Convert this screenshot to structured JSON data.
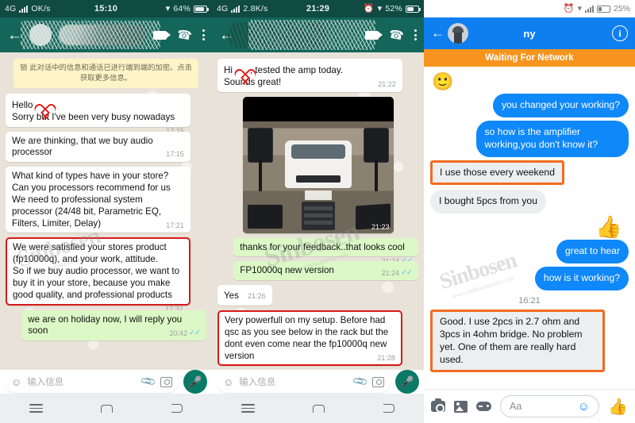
{
  "brand": {
    "watermark": "Sinbosen",
    "watermark_sub": "www.sinbosenaudio.com"
  },
  "colors": {
    "whatsapp_header": "#14655a",
    "whatsapp_statusbar": "#0f4a43",
    "whatsapp_outgoing_bubble": "#dcf8c6",
    "messenger_blue": "#0f88fa",
    "messenger_banner_orange": "#f7941e",
    "highlight_red": "#d81a1a",
    "highlight_orange": "#f26b21"
  },
  "panel1": {
    "app": "whatsapp",
    "status_bar": {
      "network": "4G",
      "speed": "OK/s",
      "time": "15:10",
      "battery": "64%",
      "wifi_icon": "wifi-icon",
      "signal_icon": "signal-bars-icon",
      "battery_icon": "battery-icon"
    },
    "header": {
      "back_icon": "back-arrow-icon",
      "contact_name": "",
      "video_icon": "video-call-icon",
      "call_icon": "voice-call-icon",
      "menu_icon": "overflow-menu-icon",
      "avatar": "contact-avatar"
    },
    "encryption_notice": "锁 此对话中的信息和通话已进行端到端的加密。点击获取更多信息。",
    "messages": [
      {
        "side": "in",
        "text": "Hello ♥\nSorry but I've been very busy nowadays",
        "time": "17:15",
        "highlight": false,
        "has_heart": true
      },
      {
        "side": "in",
        "text": "We are thinking, that we buy audio processor",
        "time": "17:15",
        "highlight": false
      },
      {
        "side": "in",
        "text": "What kind of types have in your store?\nCan you processors recommend for us\nWe need to professional system processor (24/48 bit, Parametric EQ, Filters, Limiter, Delay)",
        "time": "17:21",
        "highlight": false
      },
      {
        "side": "in",
        "text": "We were satisfied your stores product (fp10000q), and your work, attitude.\nSo if we buy audio processor, we want to buy it in your store, because you make good quality, and professional products",
        "time": "17:32",
        "highlight": true
      },
      {
        "side": "out",
        "text": "we are on holiday now, I will reply you soon",
        "time": "20:42",
        "highlight": false,
        "ticks": "✓✓"
      }
    ],
    "input": {
      "placeholder": "输入信息",
      "emoji_icon": "emoji-icon",
      "attach_icon": "attachment-clip-icon",
      "camera_icon": "camera-icon",
      "mic_icon": "microphone-icon"
    },
    "navbar": {
      "menu_icon": "android-recents-icon",
      "home_icon": "android-home-icon",
      "back_icon": "android-back-icon"
    }
  },
  "panel2": {
    "app": "whatsapp",
    "status_bar": {
      "network": "4G",
      "speed": "2.8K/s",
      "time": "21:29",
      "battery": "52%",
      "alarm_icon": "alarm-clock-icon",
      "wifi_icon": "wifi-icon",
      "signal_icon": "signal-bars-icon",
      "battery_icon": "battery-icon"
    },
    "header": {
      "back_icon": "back-arrow-icon",
      "contact_name": "",
      "video_icon": "video-call-icon",
      "call_icon": "voice-call-icon",
      "menu_icon": "overflow-menu-icon"
    },
    "messages": [
      {
        "side": "in",
        "text": "Hi ♥, tested the amp today.\nSounds great!",
        "time": "21:22",
        "highlight": false,
        "has_heart": true
      },
      {
        "side": "in",
        "type": "photo",
        "caption": "Photo of a white van in a garage with two PA speakers on stands, subwoofer cabinets and an amplifier rack",
        "time": "21:23",
        "forward_icon": "forward-arrow-icon"
      },
      {
        "side": "out",
        "text": "thanks for your feedback..that looks cool",
        "time": "21:24",
        "highlight": false,
        "ticks": "✓✓"
      },
      {
        "side": "out",
        "text": "FP10000q new version",
        "time": "21:24",
        "highlight": false,
        "ticks": "✓✓"
      },
      {
        "side": "in",
        "text": "Yes",
        "time": "21:26",
        "highlight": false,
        "inline_time": true
      },
      {
        "side": "in",
        "text": "Very powerfull on my setup. Before had qsc as you see below in the rack but the dont even come near the fp10000q new version",
        "time": "21:28",
        "highlight": true
      }
    ],
    "input": {
      "placeholder": "输入信息",
      "emoji_icon": "emoji-icon",
      "attach_icon": "attachment-clip-icon",
      "camera_icon": "camera-icon",
      "mic_icon": "microphone-icon"
    },
    "navbar": {
      "menu_icon": "android-recents-icon",
      "home_icon": "android-home-icon",
      "back_icon": "android-back-icon"
    }
  },
  "panel3": {
    "app": "messenger",
    "status_bar": {
      "battery": "25%",
      "alarm_icon": "alarm-clock-icon",
      "wifi_icon": "wifi-icon",
      "signal_icon": "signal-bars-icon",
      "battery_icon": "battery-icon"
    },
    "header": {
      "back_icon": "back-arrow-icon",
      "contact_name": "ny",
      "info_icon": "info-circle-icon",
      "avatar": "contact-avatar"
    },
    "banner": "Waiting For Network",
    "messages": [
      {
        "side": "in",
        "type": "emoji",
        "text": "🙂"
      },
      {
        "side": "out",
        "text": "you changed your working?",
        "highlight": false
      },
      {
        "side": "out",
        "text": "so how is the amplifier working,you don't know it?",
        "highlight": false
      },
      {
        "side": "in",
        "text": "I use those every weekend",
        "highlight": true
      },
      {
        "side": "in",
        "text": "I bought 5pcs from you",
        "highlight": false
      },
      {
        "side": "out",
        "type": "sticker",
        "text": "👍"
      },
      {
        "side": "out",
        "text": "great to hear",
        "highlight": false
      },
      {
        "side": "out",
        "text": "how is it working?",
        "highlight": false
      },
      {
        "side": "divider",
        "text": "16:21"
      },
      {
        "side": "in",
        "text": "Good. I use 2pcs in 2.7 ohm and 3pcs in 4ohm bridge. No problem yet. One of them are really hard used.",
        "highlight": true
      }
    ],
    "input": {
      "placeholder": "Aa",
      "camera_icon": "camera-icon",
      "gallery_icon": "gallery-icon",
      "games_icon": "games-controller-icon",
      "emoji_icon": "emoji-smiley-icon",
      "like_icon": "thumbs-up-icon"
    }
  }
}
